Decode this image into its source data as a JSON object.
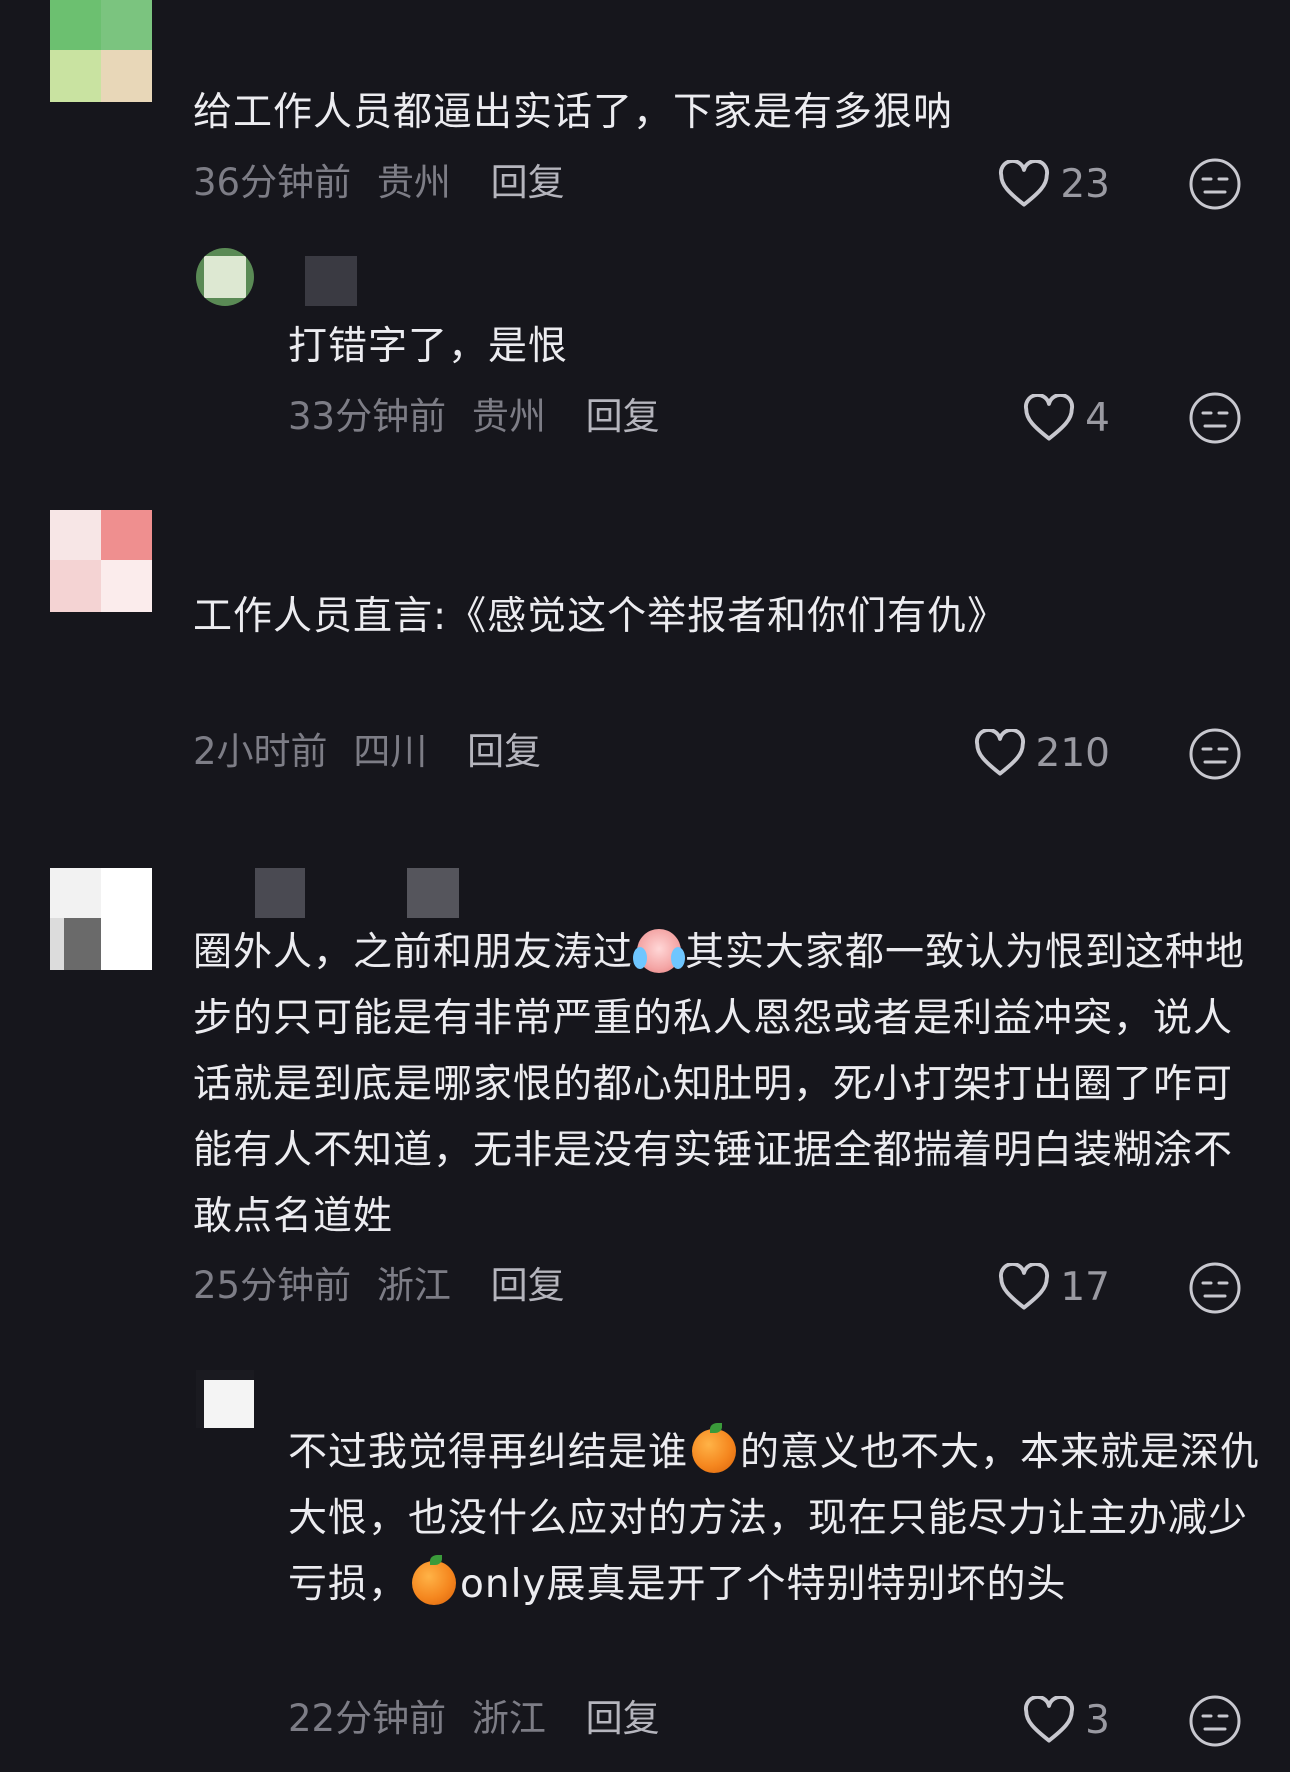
{
  "comments": [
    {
      "text": "给工作人员都逼出实话了，下家是有多狠呐",
      "time": "36分钟前",
      "location": "贵州",
      "reply_label": "回复",
      "likes": "23",
      "replies": [
        {
          "text": "打错字了，是恨",
          "time": "33分钟前",
          "location": "贵州",
          "reply_label": "回复",
          "likes": "4"
        }
      ]
    },
    {
      "text": "工作人员直言:《感觉这个举报者和你们有仇》",
      "time": "2小时前",
      "location": "四川",
      "reply_label": "回复",
      "likes": "210"
    },
    {
      "text_part1": "圈外人，之前和朋友涛过",
      "text_part2": "其实大家都一致认为恨到这种地步的只可能是有非常严重的私人恩怨或者是利益冲突，说人话就是到底是哪家恨的都心知肚明，死小打架打出圈了咋可能有人不知道，无非是没有实锤证据全都揣着明白装糊涂不敢点名道姓",
      "time": "25分钟前",
      "location": "浙江",
      "reply_label": "回复",
      "likes": "17",
      "replies": [
        {
          "text_part1": "不过我觉得再纠结是谁",
          "text_part2": "的意义也不大，本来就是深仇大恨，也没什么应对的方法，现在只能尽力让主办减少亏损，",
          "text_part3": "only展真是开了个特别特别坏的头",
          "time": "22分钟前",
          "location": "浙江",
          "reply_label": "回复",
          "likes": "3"
        }
      ]
    }
  ],
  "icons": {
    "like": "heart-outline-icon",
    "dislike": "neutral-face-icon",
    "emoji_cry": "crying-face-emoji",
    "emoji_orange": "orange-emoji"
  },
  "colors": {
    "background": "#16161c",
    "text": "#ececf0",
    "meta": "#7d7d86",
    "reply": "#b5b5bd"
  }
}
